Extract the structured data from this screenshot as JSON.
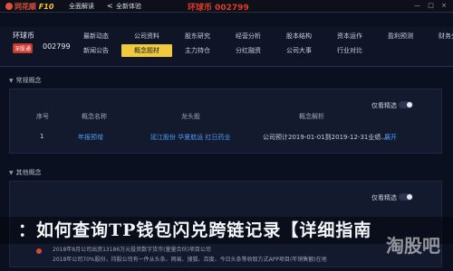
{
  "titlebar": {
    "logo_text": "同花顺",
    "logo_f10": "F10",
    "menu_all": "全面解读",
    "menu_full": "全新体验",
    "back": "<",
    "stock_title": "环球币 002799",
    "window_controls": "— □ ×"
  },
  "stock": {
    "name": "环球币",
    "badge": "深股通",
    "code": "002799"
  },
  "nav": {
    "row1": [
      "最新动态",
      "公司资料",
      "股东研究",
      "经营分析",
      "股本结构",
      "资本运作",
      "盈利预测",
      "财务分析"
    ],
    "row2": [
      "新闻公告",
      "概念题材",
      "主力持仓",
      "分红融资",
      "公司大事",
      "行业对比",
      "",
      ""
    ],
    "active": "概念题材"
  },
  "section1": {
    "title": "常规概念",
    "toggle_label": "仅看精选",
    "columns": [
      "序号",
      "概念名称",
      "龙头股",
      "概念解析"
    ],
    "rows": [
      {
        "num": "1",
        "name": "年报预增",
        "leaders": "延江股份  华夏航运  红日药业",
        "desc": "公司预计2019-01-01到2019-12-31业绩...",
        "more": "展开"
      }
    ]
  },
  "section2": {
    "title": "其他概念",
    "toggle_label": "仅看精选"
  },
  "overlay": {
    "title": "：如何查询TP钱包闪兑跨链记录【详细指南",
    "watermark": "淘股吧",
    "line1": "2018年8月公司出资13186万元投资数字货币(量量合伙)项目公司",
    "line2": "2018年公司70%股份，持股公司有一件从头条、网易、搜狐、百度、今日头条等收取方式APP项目(年销售额)在地"
  },
  "colors": {
    "active_tab": "#f0c93c",
    "stock_title": "#e43b2b",
    "link": "#4f9bf0",
    "badge": "#c8392b"
  }
}
